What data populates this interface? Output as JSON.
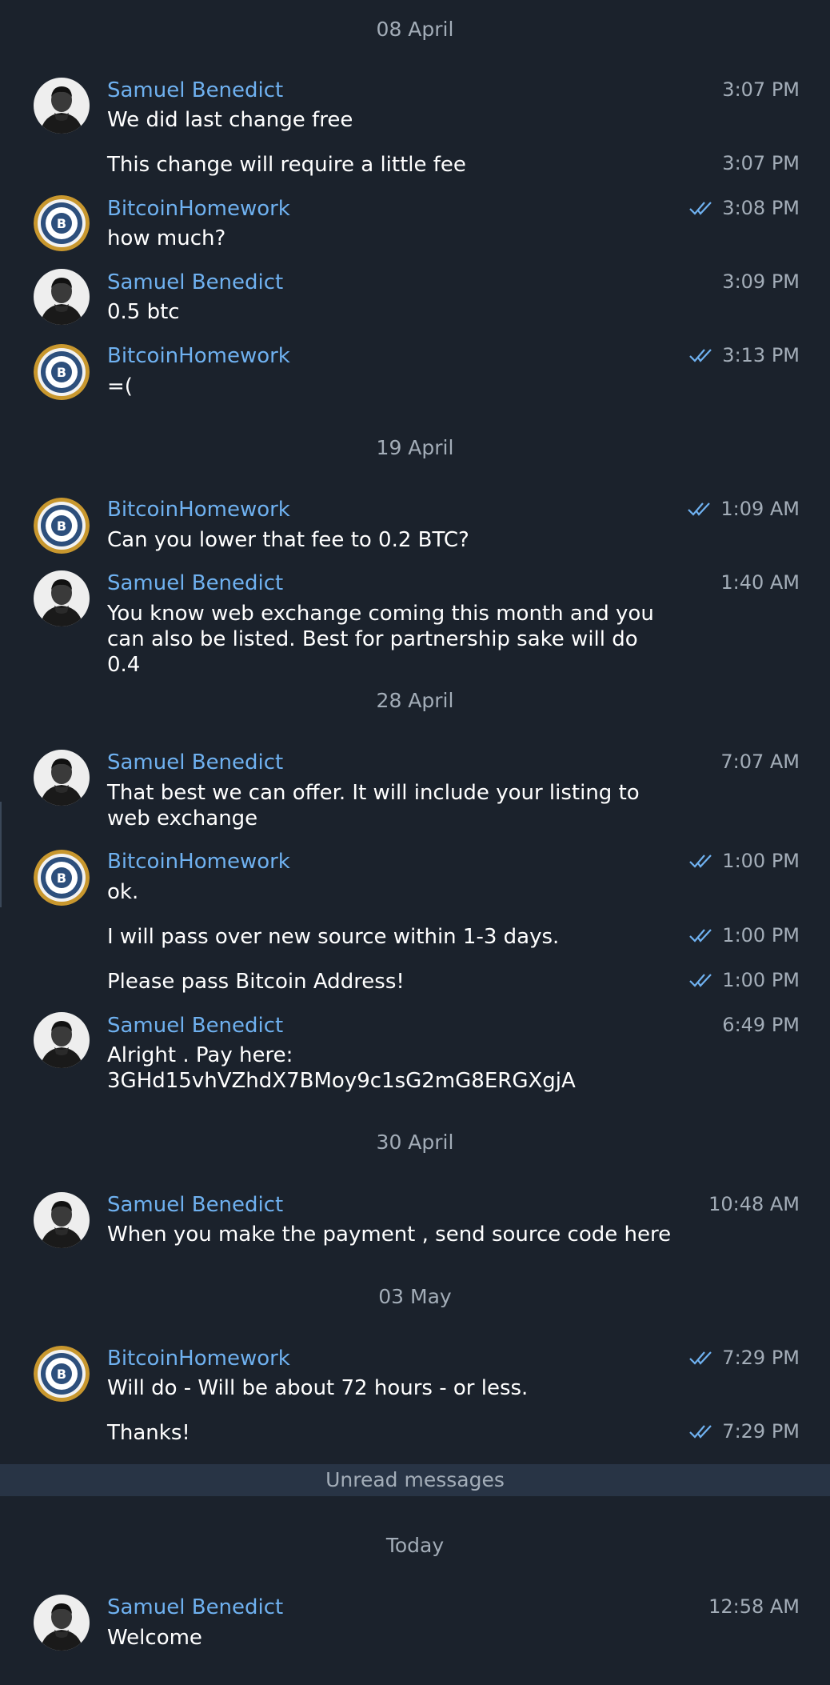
{
  "colors": {
    "background": "#1b222c",
    "name": "#6fb1f0",
    "time": "#a3adb8",
    "text": "#ffffff",
    "unread_bar": "#283445",
    "ticks": "#6fb1f0"
  },
  "dates": {
    "d1": "08 April",
    "d2": "19 April",
    "d3": "28 April",
    "d4": "30 April",
    "d5": "03 May",
    "d6": "Today"
  },
  "unread_label": "Unread messages",
  "senders": {
    "samuel": "Samuel Benedict",
    "btc": "BitcoinHomework"
  },
  "messages": {
    "m1": {
      "text": "We did last change free",
      "time": "3:07 PM"
    },
    "m2": {
      "text": "This change will require a little fee",
      "time": "3:07 PM"
    },
    "m3": {
      "text": "how much?",
      "time": "3:08 PM"
    },
    "m4": {
      "text": "0.5 btc",
      "time": "3:09 PM"
    },
    "m5": {
      "text": "=(",
      "time": "3:13 PM"
    },
    "m6": {
      "text": "Can you lower that fee to 0.2 BTC?",
      "time": "1:09 AM"
    },
    "m7": {
      "text": "You know web exchange coming this month and you can also be listed.  Best for partnership sake will do 0.4",
      "time": "1:40 AM"
    },
    "m8": {
      "text": "That best we can offer.  It will include your listing to web exchange",
      "time": "7:07 AM"
    },
    "m9": {
      "text": "ok.",
      "time": "1:00 PM"
    },
    "m10": {
      "text": "I will pass over new source within 1-3 days.",
      "time": "1:00 PM"
    },
    "m11": {
      "text": "Please pass Bitcoin Address!",
      "time": "1:00 PM"
    },
    "m12": {
      "text": "Alright . Pay here: 3GHd15vhVZhdX7BMoy9c1sG2mG8ERGXgjA",
      "time": "6:49 PM"
    },
    "m13": {
      "text": "When you make the payment , send source code here",
      "time": "10:48 AM"
    },
    "m14": {
      "text": "Will do - Will be about 72 hours - or less.",
      "time": "7:29 PM"
    },
    "m15": {
      "text": "Thanks!",
      "time": "7:29 PM"
    },
    "m16": {
      "text": "Welcome",
      "time": "12:58 AM"
    }
  },
  "icons": {
    "samuel_avatar": "person-photo",
    "btc_avatar": "bitcoin-seal-badge",
    "read": "double-check-icon"
  }
}
